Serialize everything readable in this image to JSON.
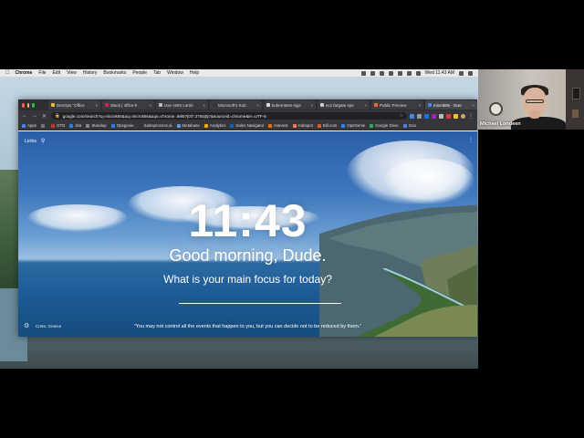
{
  "menubar": {
    "app": "Chrome",
    "items": [
      "File",
      "Edit",
      "View",
      "History",
      "Bookmarks",
      "People",
      "Tab",
      "Window",
      "Help"
    ],
    "clock": "Wed 11:43 AM"
  },
  "tabs": [
    {
      "label": "DevOps \"Office",
      "color": "#f2b731"
    },
    {
      "label": "Slack | office-h",
      "color": "#e01e5a"
    },
    {
      "label": "Use AWS Lamb",
      "color": "#bbbbbb"
    },
    {
      "label": "Microsoft's Kub",
      "color": "#333333"
    },
    {
      "label": "kubernetes-sigs",
      "color": "#dddddd"
    },
    {
      "label": "ecs fargate spe",
      "color": "#cccccc"
    },
    {
      "label": "Public Preview",
      "color": "#f26b3a"
    },
    {
      "label": "microk8s - Goo",
      "color": "#4285f4"
    }
  ],
  "omnibox": {
    "url": "google.com/search?q=microk8s&oq=microk8s&aqs=chrome..69i57j0l7.3755j0j7&sourceid=chrome&ie=UTF-8"
  },
  "bookmarks": [
    {
      "label": "Apps",
      "color": "#4285f4"
    },
    {
      "label": "",
      "color": "#777777"
    },
    {
      "label": "GTD",
      "color": "#cc3333"
    },
    {
      "label": "Jira",
      "color": "#2684ff"
    },
    {
      "label": "Standup",
      "color": "#888888"
    },
    {
      "label": "Opsgenie",
      "color": "#2684ff"
    },
    {
      "label": "Salesprocess.ai",
      "color": "#333333"
    },
    {
      "label": "Metabase",
      "color": "#509ee3"
    },
    {
      "label": "Analytics",
      "color": "#f9ab00"
    },
    {
      "label": "Sales Navigator",
      "color": "#0a66c2"
    },
    {
      "label": "Harvest",
      "color": "#f36c00"
    },
    {
      "label": "Hubspot",
      "color": "#ff7a59"
    },
    {
      "label": "Bill.com",
      "color": "#e35a2b"
    },
    {
      "label": "OpsGenie",
      "color": "#2684ff"
    },
    {
      "label": "Google Drive",
      "color": "#34a853"
    },
    {
      "label": "Goo",
      "color": "#4285f4"
    }
  ],
  "newtab": {
    "links_label": "Links",
    "clock": "11:43",
    "greeting": "Good morning, Dude.",
    "focus_prompt": "What is your main focus for today?",
    "location": "Crete, Greece",
    "quote": "\"You may not control all the events that happen to you, but you can decide not to be reduced by them.\""
  },
  "webcam": {
    "name": "Michael Londeen"
  }
}
